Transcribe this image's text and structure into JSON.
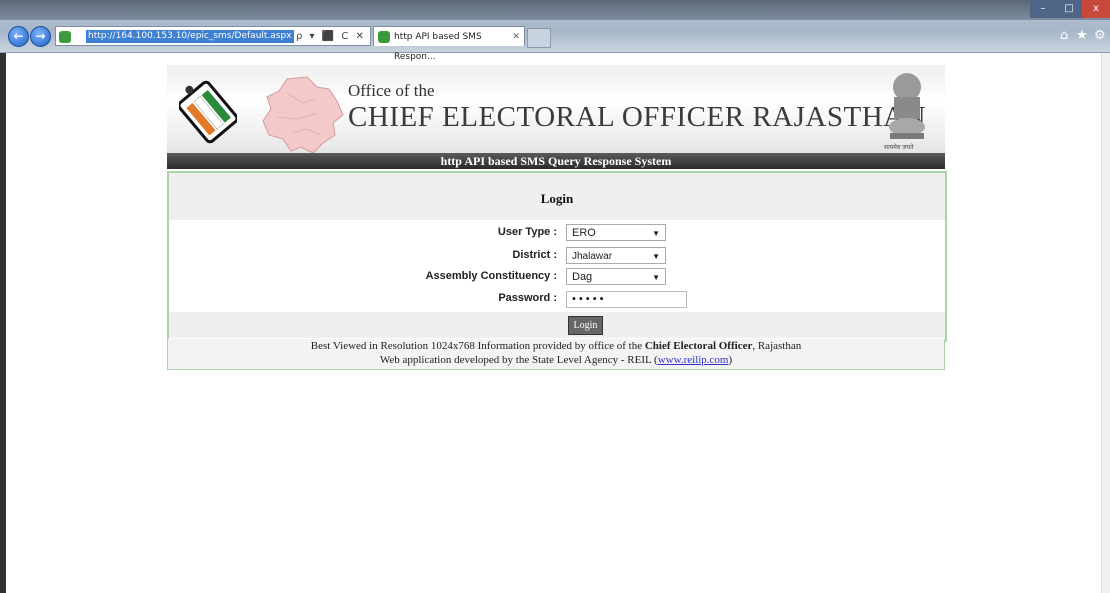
{
  "browser": {
    "back_icon": "back-arrow-icon",
    "forward_icon": "forward-arrow-icon",
    "url": "http://164.100.153.10/epic_sms/Default.aspx",
    "address_controls": "ρ ▾ ⬛ C ✕",
    "tab_title": "http API based SMS Respon...",
    "tab_close": "✕"
  },
  "header": {
    "office_of": "Office of the",
    "org_name": "CHIEF ELECTORAL OFFICER RAJASTHAN",
    "emblem_text": "सत्यमेव जयते"
  },
  "system_title": "http API based SMS Query Response System",
  "login": {
    "heading": "Login",
    "user_type_label": "User Type :",
    "user_type_value": "ERO",
    "district_label": "District :",
    "district_value": "Jhalawar",
    "ac_label": "Assembly Constituency :",
    "ac_value": "Dag",
    "password_label": "Password :",
    "password_value": "•••••",
    "button_label": "Login"
  },
  "footer": {
    "line1_a": "Best Viewed in Resolution 1024x768 Information provided by office of the ",
    "line1_bold": "Chief Electoral Officer",
    "line1_b": ", Rajasthan",
    "line2_a": "Web application developed by the State Level Agency - REIL (",
    "line2_link": "www.reilip.com",
    "line2_b": ")"
  },
  "colors": {
    "title_bar": "#3a3a3a",
    "login_border": "#a9d5a9",
    "panel_bg": "#efefef"
  }
}
